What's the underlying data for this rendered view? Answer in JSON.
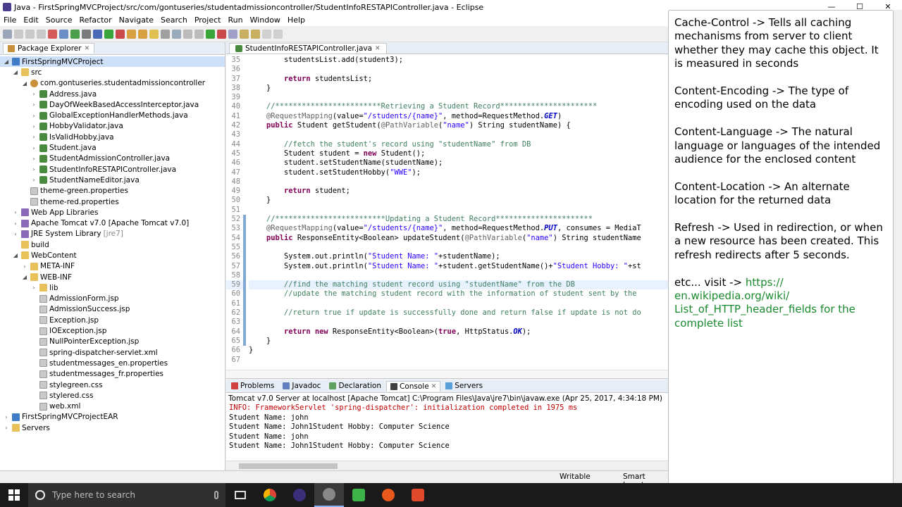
{
  "window": {
    "title": "Java - FirstSpringMVCProject/src/com/gontuseries/studentadmissioncontroller/StudentInfoRESTAPIController.java - Eclipse",
    "minimize": "—",
    "maximize": "☐",
    "close": "✕"
  },
  "menu": [
    "File",
    "Edit",
    "Source",
    "Refactor",
    "Navigate",
    "Search",
    "Project",
    "Run",
    "Window",
    "Help"
  ],
  "package_explorer": {
    "title": "Package Explorer",
    "tree": [
      {
        "label": "FirstSpringMVCProject",
        "depth": 0,
        "twisty": "◢",
        "icon": "proj",
        "selected": true
      },
      {
        "label": "src",
        "depth": 1,
        "twisty": "◢",
        "icon": "folder"
      },
      {
        "label": "com.gontuseries.studentadmissioncontroller",
        "depth": 2,
        "twisty": "◢",
        "icon": "pkg"
      },
      {
        "label": "Address.java",
        "depth": 3,
        "twisty": "›",
        "icon": "java"
      },
      {
        "label": "DayOfWeekBasedAccessInterceptor.java",
        "depth": 3,
        "twisty": "›",
        "icon": "java"
      },
      {
        "label": "GlobalExceptionHandlerMethods.java",
        "depth": 3,
        "twisty": "›",
        "icon": "java"
      },
      {
        "label": "HobbyValidator.java",
        "depth": 3,
        "twisty": "›",
        "icon": "java"
      },
      {
        "label": "IsValidHobby.java",
        "depth": 3,
        "twisty": "›",
        "icon": "java"
      },
      {
        "label": "Student.java",
        "depth": 3,
        "twisty": "›",
        "icon": "java"
      },
      {
        "label": "StudentAdmissionController.java",
        "depth": 3,
        "twisty": "›",
        "icon": "java"
      },
      {
        "label": "StudentInfoRESTAPIController.java",
        "depth": 3,
        "twisty": "›",
        "icon": "java"
      },
      {
        "label": "StudentNameEditor.java",
        "depth": 3,
        "twisty": "›",
        "icon": "java"
      },
      {
        "label": "theme-green.properties",
        "depth": 2,
        "twisty": "",
        "icon": "file"
      },
      {
        "label": "theme-red.properties",
        "depth": 2,
        "twisty": "",
        "icon": "file"
      },
      {
        "label": "Web App Libraries",
        "depth": 1,
        "twisty": "›",
        "icon": "lib"
      },
      {
        "label": "Apache Tomcat v7.0 [Apache Tomcat v7.0]",
        "depth": 1,
        "twisty": "›",
        "icon": "lib"
      },
      {
        "label": "JRE System Library",
        "suffix": "[jre7]",
        "depth": 1,
        "twisty": "›",
        "icon": "lib"
      },
      {
        "label": "build",
        "depth": 1,
        "twisty": "",
        "icon": "folder"
      },
      {
        "label": "WebContent",
        "depth": 1,
        "twisty": "◢",
        "icon": "folder"
      },
      {
        "label": "META-INF",
        "depth": 2,
        "twisty": "›",
        "icon": "folder"
      },
      {
        "label": "WEB-INF",
        "depth": 2,
        "twisty": "◢",
        "icon": "folder"
      },
      {
        "label": "lib",
        "depth": 3,
        "twisty": "›",
        "icon": "folder"
      },
      {
        "label": "AdmissionForm.jsp",
        "depth": 3,
        "twisty": "",
        "icon": "file"
      },
      {
        "label": "AdmissionSuccess.jsp",
        "depth": 3,
        "twisty": "",
        "icon": "file"
      },
      {
        "label": "Exception.jsp",
        "depth": 3,
        "twisty": "",
        "icon": "file"
      },
      {
        "label": "IOException.jsp",
        "depth": 3,
        "twisty": "",
        "icon": "file"
      },
      {
        "label": "NullPointerException.jsp",
        "depth": 3,
        "twisty": "",
        "icon": "file"
      },
      {
        "label": "spring-dispatcher-servlet.xml",
        "depth": 3,
        "twisty": "",
        "icon": "file"
      },
      {
        "label": "studentmessages_en.properties",
        "depth": 3,
        "twisty": "",
        "icon": "file"
      },
      {
        "label": "studentmessages_fr.properties",
        "depth": 3,
        "twisty": "",
        "icon": "file"
      },
      {
        "label": "stylegreen.css",
        "depth": 3,
        "twisty": "",
        "icon": "file"
      },
      {
        "label": "stylered.css",
        "depth": 3,
        "twisty": "",
        "icon": "file"
      },
      {
        "label": "web.xml",
        "depth": 3,
        "twisty": "",
        "icon": "file"
      },
      {
        "label": "FirstSpringMVCProjectEAR",
        "depth": 0,
        "twisty": "›",
        "icon": "proj"
      },
      {
        "label": "Servers",
        "depth": 0,
        "twisty": "›",
        "icon": "folder"
      }
    ]
  },
  "editor": {
    "tab": "StudentInfoRESTAPIController.java",
    "lines": [
      {
        "n": "35",
        "text": "        studentsList.add(student3);"
      },
      {
        "n": "36",
        "text": ""
      },
      {
        "n": "37",
        "text": "        return studentsList;"
      },
      {
        "n": "38",
        "text": "    }"
      },
      {
        "n": "39",
        "text": ""
      },
      {
        "n": "40",
        "text": "    //************************Retrieving a Student Record**********************"
      },
      {
        "n": "41",
        "text": "    @RequestMapping(value=\"/students/{name}\", method=RequestMethod.GET)"
      },
      {
        "n": "42",
        "text": "    public Student getStudent(@PathVariable(\"name\") String studentName) {"
      },
      {
        "n": "43",
        "text": ""
      },
      {
        "n": "44",
        "text": "        //fetch the student's record using \"studentName\" from DB"
      },
      {
        "n": "45",
        "text": "        Student student = new Student();"
      },
      {
        "n": "46",
        "text": "        student.setStudentName(studentName);"
      },
      {
        "n": "47",
        "text": "        student.setStudentHobby(\"WWE\");"
      },
      {
        "n": "48",
        "text": ""
      },
      {
        "n": "49",
        "text": "        return student;"
      },
      {
        "n": "50",
        "text": "    }"
      },
      {
        "n": "51",
        "text": ""
      },
      {
        "n": "52",
        "text": "    //*************************Updating a Student Record**********************"
      },
      {
        "n": "53",
        "text": "    @RequestMapping(value=\"/students/{name}\", method=RequestMethod.PUT, consumes = MediaT"
      },
      {
        "n": "54",
        "text": "    public ResponseEntity<Boolean> updateStudent(@PathVariable(\"name\") String studentName"
      },
      {
        "n": "55",
        "text": ""
      },
      {
        "n": "56",
        "text": "        System.out.println(\"Student Name: \"+studentName);"
      },
      {
        "n": "57",
        "text": "        System.out.println(\"Student Name: \"+student.getStudentName()+\"Student Hobby: \"+st"
      },
      {
        "n": "58",
        "text": ""
      },
      {
        "n": "59",
        "text": "        //find the matching student record using \"studentName\" from the DB"
      },
      {
        "n": "60",
        "text": "        //update the matching student record with the information of student sent by the"
      },
      {
        "n": "61",
        "text": ""
      },
      {
        "n": "62",
        "text": "        //return true if update is successfully done and return false if update is not do"
      },
      {
        "n": "63",
        "text": ""
      },
      {
        "n": "64",
        "text": "        return new ResponseEntity<Boolean>(true, HttpStatus.OK);"
      },
      {
        "n": "65",
        "text": "    }"
      },
      {
        "n": "66",
        "text": "}"
      },
      {
        "n": "67",
        "text": ""
      }
    ]
  },
  "console": {
    "tabs": [
      "Problems",
      "Javadoc",
      "Declaration",
      "Console",
      "Servers"
    ],
    "header": "Tomcat v7.0 Server at localhost [Apache Tomcat] C:\\Program Files\\Java\\jre7\\bin\\javaw.exe (Apr 25, 2017, 4:34:18 PM)",
    "lines": [
      {
        "text": "INFO: FrameworkServlet 'spring-dispatcher': initialization completed in 1975 ms",
        "err": true
      },
      {
        "text": "Student Name: john",
        "err": false
      },
      {
        "text": "Student Name: John1Student Hobby: Computer Science",
        "err": false
      },
      {
        "text": "Student Name: john",
        "err": false
      },
      {
        "text": "Student Name: John1Student Hobby: Computer Science",
        "err": false
      }
    ]
  },
  "status": {
    "writable": "Writable",
    "insert": "Smart Insert"
  },
  "overlay": {
    "paragraphs": [
      "Cache-Control -> Tells all caching mechanisms from server to client whether they may cache this object. It is measured in seconds",
      "Content-Encoding -> The type of encoding used on the data",
      "Content-Language -> The natural language or languages of the intended audience for the enclosed content",
      "Content-Location -> An alternate location for the returned data",
      "Refresh -> Used in redirection, or when a new resource has been created. This refresh redirects after 5 seconds."
    ],
    "etc_prefix": "etc...  visit -> ",
    "etc_link": "https:// en.wikipedia.org/wiki/ List_of_HTTP_header_fields for the complete list"
  },
  "taskbar": {
    "search_placeholder": "Type here to search"
  }
}
